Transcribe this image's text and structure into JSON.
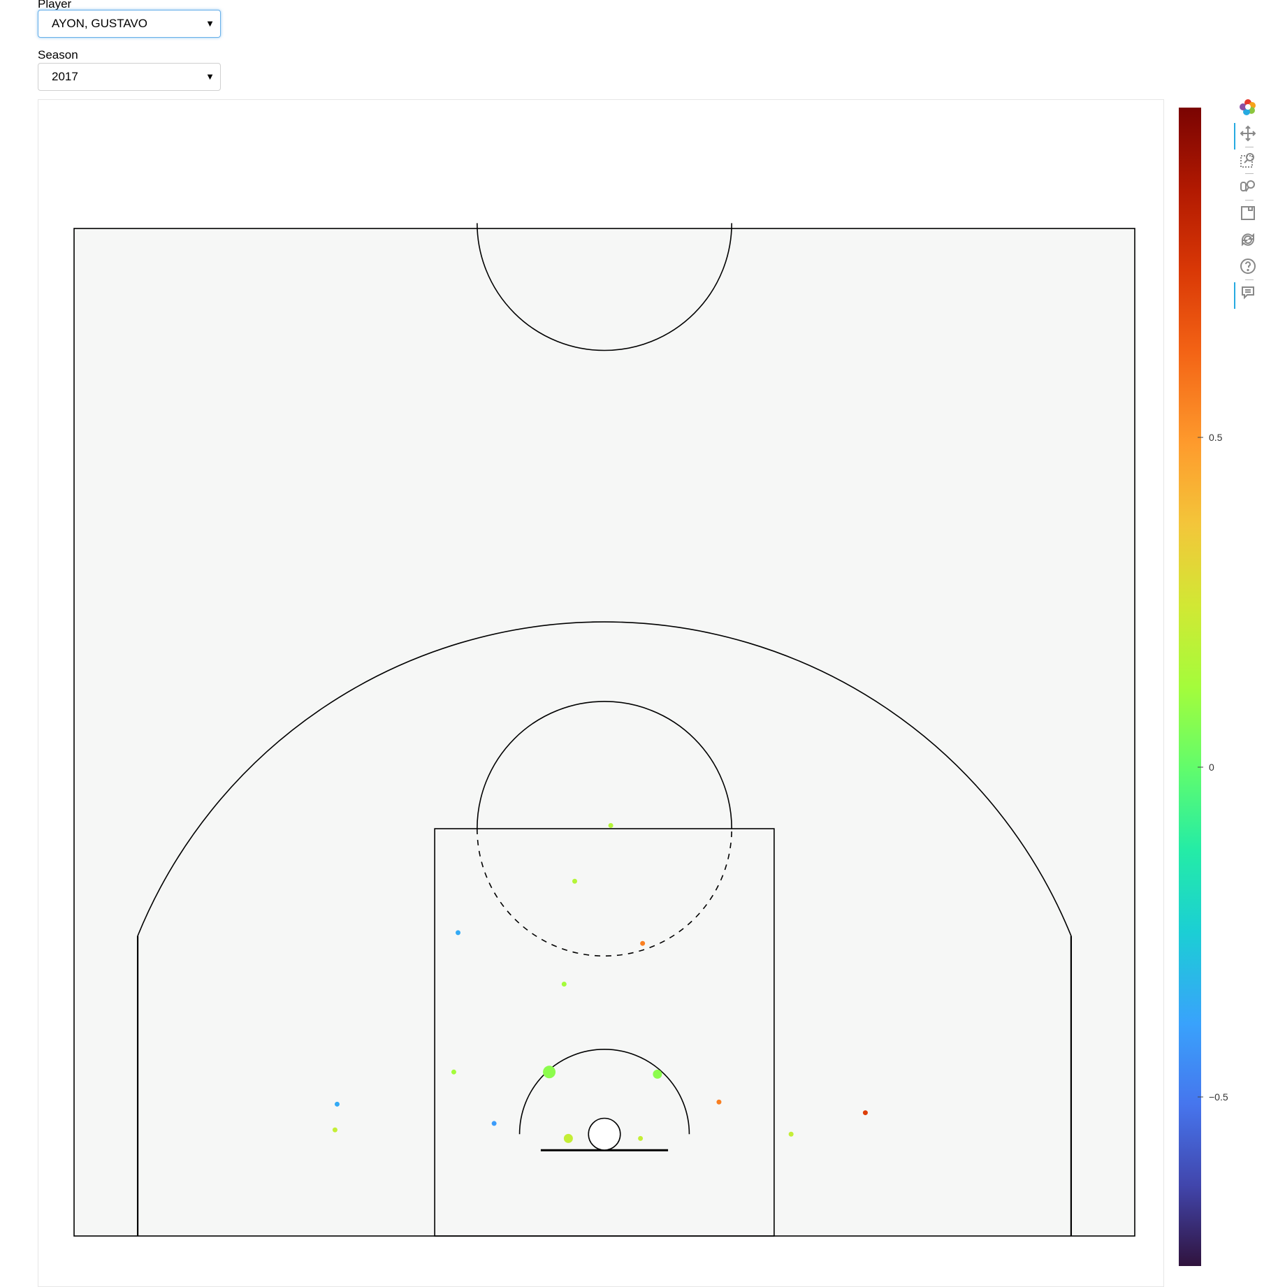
{
  "controls": {
    "player_label": "Player",
    "player_value": "AYON, GUSTAVO",
    "season_label": "Season",
    "season_value": "2017"
  },
  "toolbar": {
    "tools": [
      "bokeh-logo-icon",
      "pan-icon",
      "box-zoom-icon",
      "wheel-zoom-icon",
      "save-icon",
      "reset-icon",
      "help-icon",
      "hover-icon"
    ],
    "active": [
      "pan-icon",
      "hover-icon"
    ]
  },
  "chart_data": {
    "type": "scatter",
    "title": "",
    "xlabel": "",
    "ylabel": "",
    "xlim": [
      -250,
      250
    ],
    "ylim": [
      -47.5,
      422.5
    ],
    "grid": false,
    "court_color": "#f6f7f6",
    "colorbar": {
      "palette": "turbo",
      "range": [
        -1,
        1
      ],
      "ticks": [
        0.5,
        0,
        -0.5
      ],
      "tick_labels": [
        "0.5",
        "0",
        "−0.5"
      ]
    },
    "points": [
      {
        "x": 3,
        "y": 144,
        "value": 0.05,
        "size": 1
      },
      {
        "x": -14,
        "y": 118,
        "value": 0.05,
        "size": 1
      },
      {
        "x": -69,
        "y": 94,
        "value": -0.55,
        "size": 1
      },
      {
        "x": 18,
        "y": 89,
        "value": 0.5,
        "size": 1
      },
      {
        "x": -19,
        "y": 70,
        "value": 0.0,
        "size": 1
      },
      {
        "x": -71,
        "y": 29,
        "value": 0.0,
        "size": 1
      },
      {
        "x": -26,
        "y": 29,
        "value": -0.05,
        "size": 3
      },
      {
        "x": 25,
        "y": 28,
        "value": -0.05,
        "size": 2
      },
      {
        "x": -126,
        "y": 14,
        "value": -0.55,
        "size": 1
      },
      {
        "x": 54,
        "y": 15,
        "value": 0.5,
        "size": 1
      },
      {
        "x": 123,
        "y": 10,
        "value": 0.7,
        "size": 1
      },
      {
        "x": -52,
        "y": 5,
        "value": -0.6,
        "size": 1
      },
      {
        "x": -127,
        "y": 2,
        "value": 0.1,
        "size": 1
      },
      {
        "x": -17,
        "y": -2,
        "value": 0.1,
        "size": 2
      },
      {
        "x": 17,
        "y": -2,
        "value": 0.1,
        "size": 1
      },
      {
        "x": 88,
        "y": 0,
        "value": 0.1,
        "size": 1
      }
    ]
  }
}
